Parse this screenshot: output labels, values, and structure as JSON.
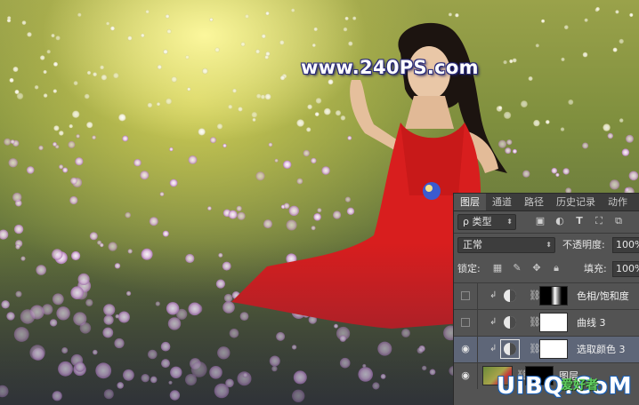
{
  "watermark": "www.240PS.com",
  "footer_watermark": {
    "main": "UiBQ.CoM",
    "sub": "爱好者"
  },
  "panel": {
    "tabs": [
      {
        "label": "图层",
        "active": true
      },
      {
        "label": "通道",
        "active": false
      },
      {
        "label": "路径",
        "active": false
      },
      {
        "label": "历史记录",
        "active": false
      },
      {
        "label": "动作",
        "active": false
      }
    ],
    "filter": {
      "label": "ρ 类型",
      "icons": [
        "image-icon",
        "adjustment-icon",
        "type-icon",
        "shape-icon",
        "smart-object-icon"
      ]
    },
    "blend_mode": "正常",
    "opacity_label": "不透明度:",
    "opacity_value": "100%",
    "lock_label": "锁定:",
    "fill_label": "填充:",
    "fill_value": "100%",
    "layers": [
      {
        "name": "色相/饱和度",
        "visible": false,
        "clipped": true,
        "mask": "dark",
        "selected": false,
        "type": "adjustment"
      },
      {
        "name": "曲线 3",
        "visible": false,
        "clipped": true,
        "mask": "white",
        "selected": false,
        "type": "adjustment"
      },
      {
        "name": "选取颜色 3",
        "visible": true,
        "clipped": true,
        "mask": "white",
        "selected": true,
        "type": "adjustment"
      },
      {
        "name": "图层",
        "visible": true,
        "clipped": false,
        "mask": "dark",
        "selected": false,
        "type": "pixel"
      }
    ]
  },
  "colors": {
    "panel_bg": "#535353",
    "tab_bar": "#3c3c3c",
    "selected_row": "#5e6678",
    "dress": "#d81e1e"
  }
}
